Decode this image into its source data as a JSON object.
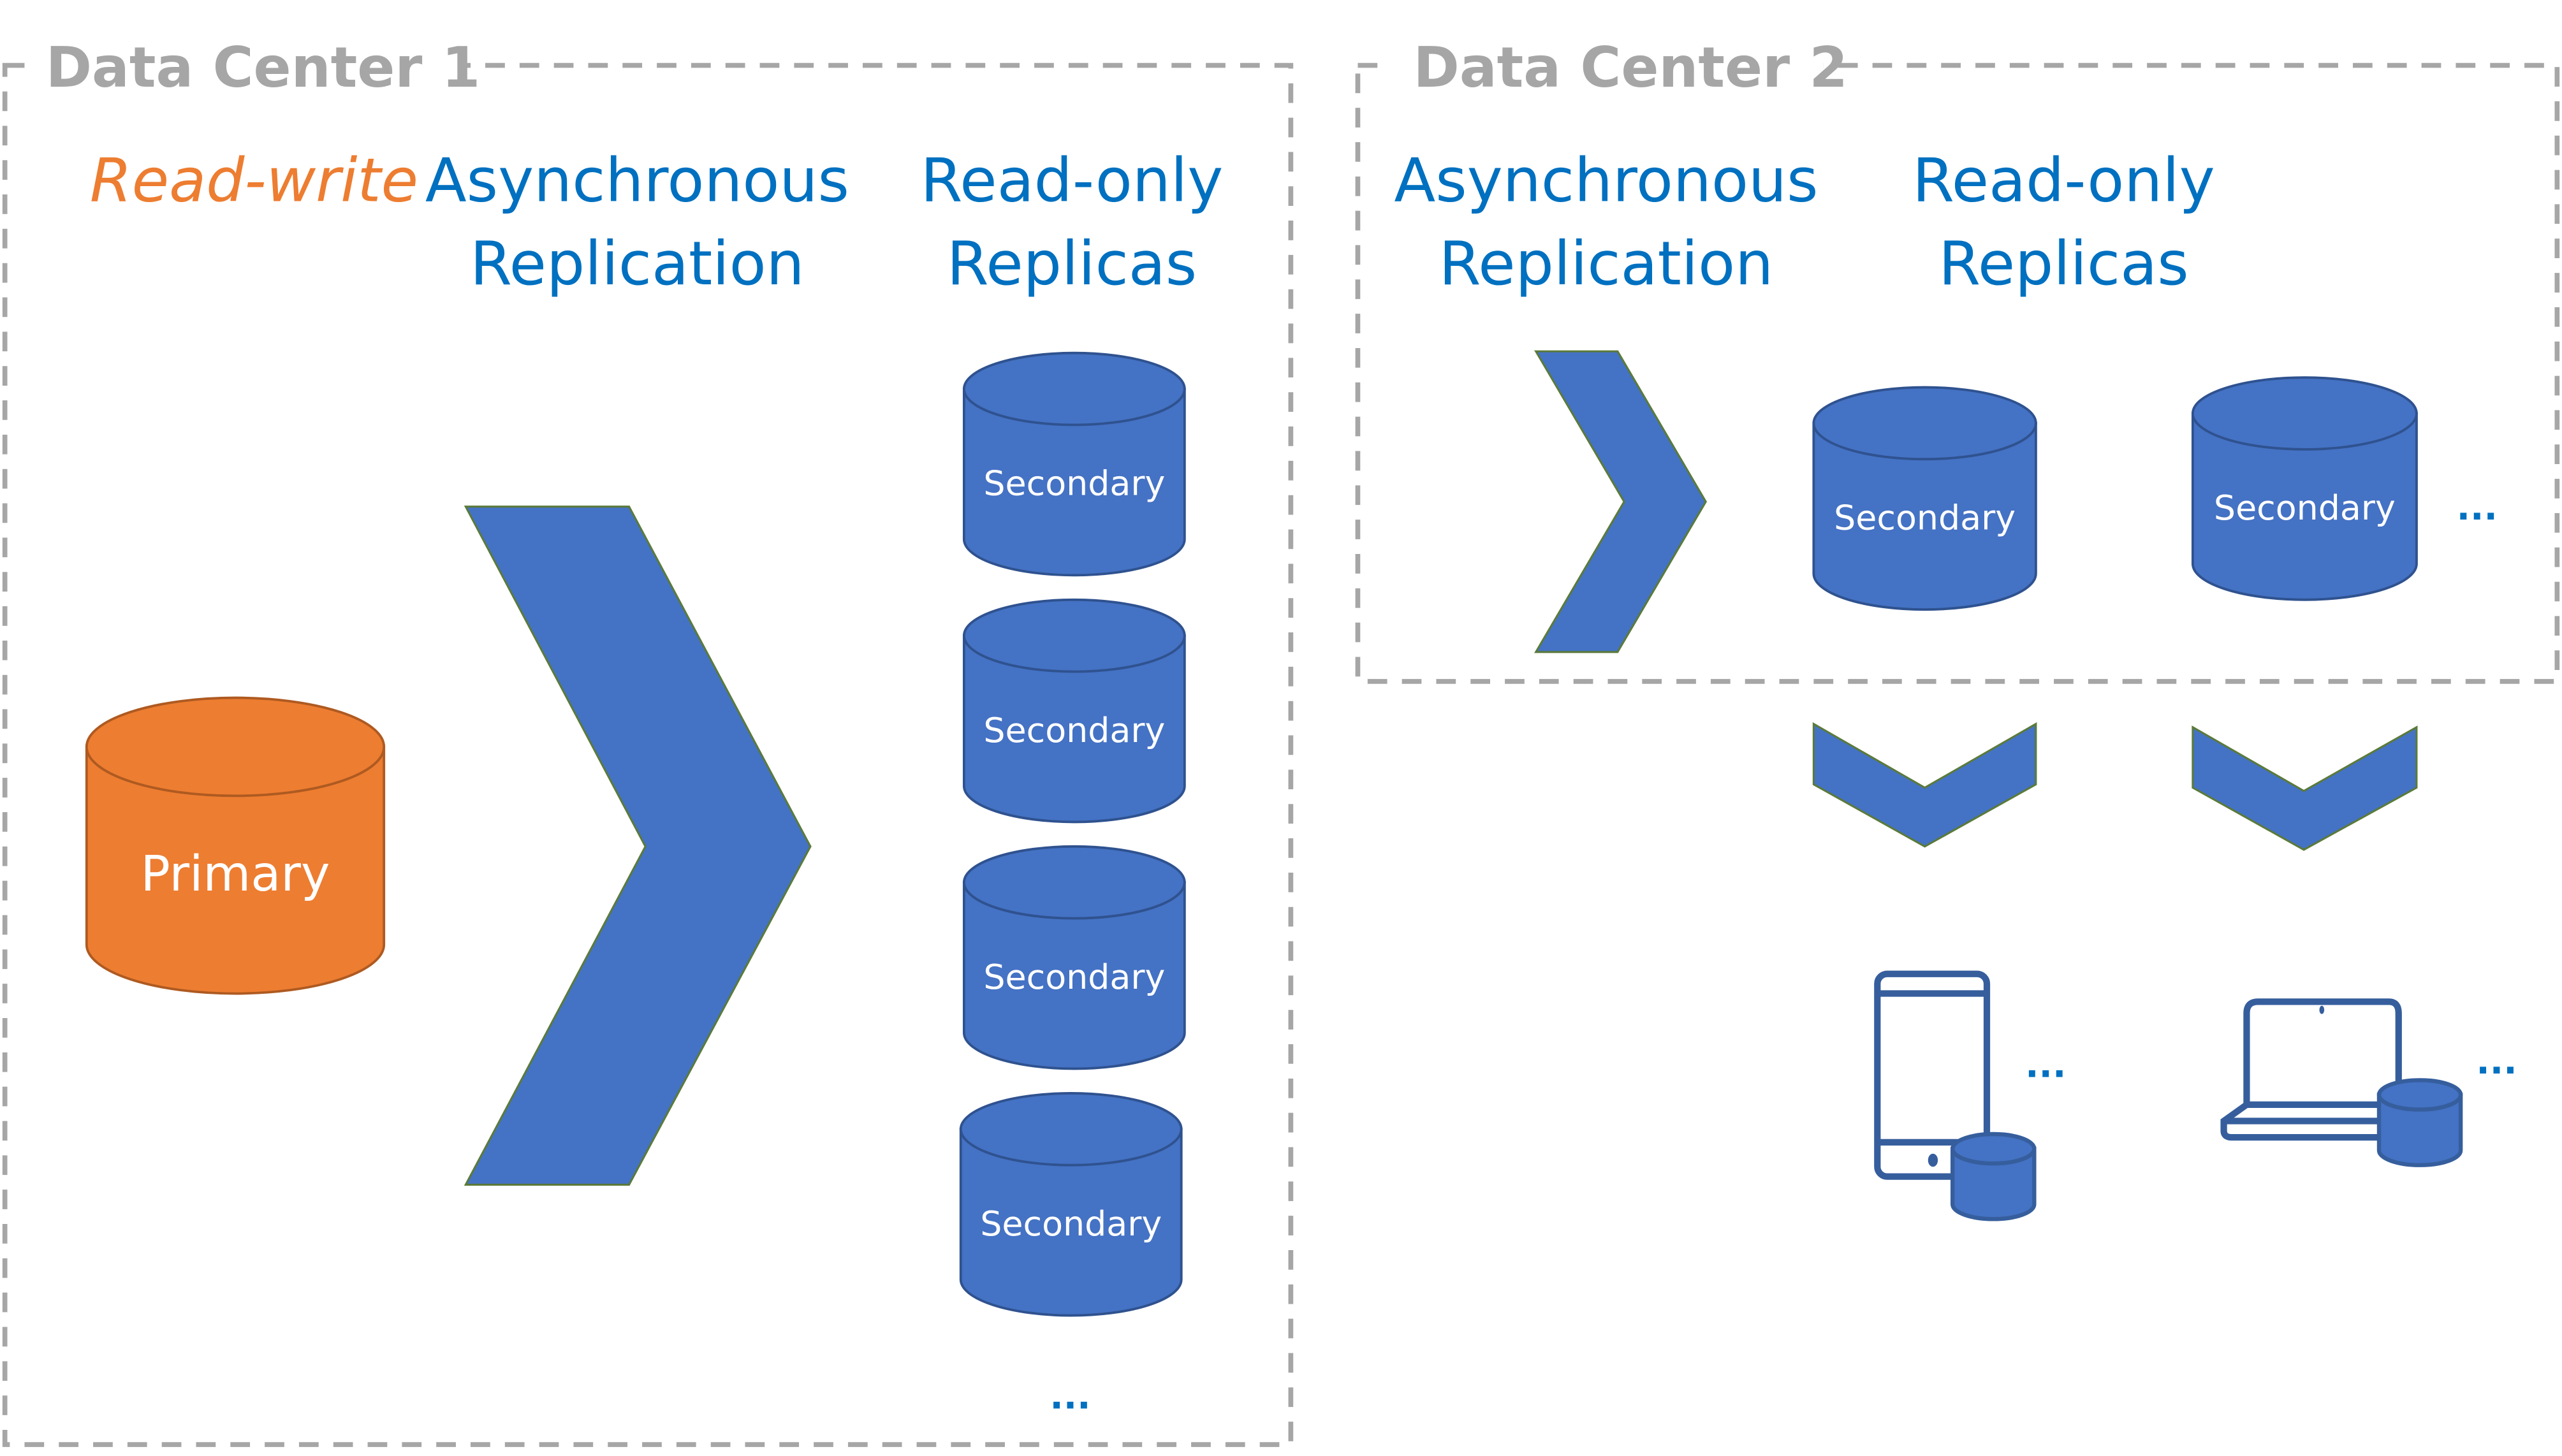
{
  "colors": {
    "primary": "#ed7d31",
    "secondary": "#4472c4",
    "label": "#0070c0",
    "border": "#a6a6a6"
  },
  "dc1": {
    "title": "Data Center 1",
    "read_write": "Read-write",
    "replication_line1": "Asynchronous",
    "replication_line2": "Replication",
    "replicas_line1": "Read-only",
    "replicas_line2": "Replicas",
    "primary": "Primary",
    "secondaries": [
      "Secondary",
      "Secondary",
      "Secondary",
      "Secondary"
    ],
    "more": "..."
  },
  "dc2": {
    "title": "Data Center 2",
    "replication_line1": "Asynchronous",
    "replication_line2": "Replication",
    "replicas_line1": "Read-only",
    "replicas_line2": "Replicas",
    "secondaries": [
      "Secondary",
      "Secondary"
    ],
    "more": "..."
  },
  "clients": {
    "icons": [
      "mobile-phone-with-database-icon",
      "laptop-with-database-icon"
    ],
    "phone_more": "...",
    "laptop_more": "..."
  }
}
